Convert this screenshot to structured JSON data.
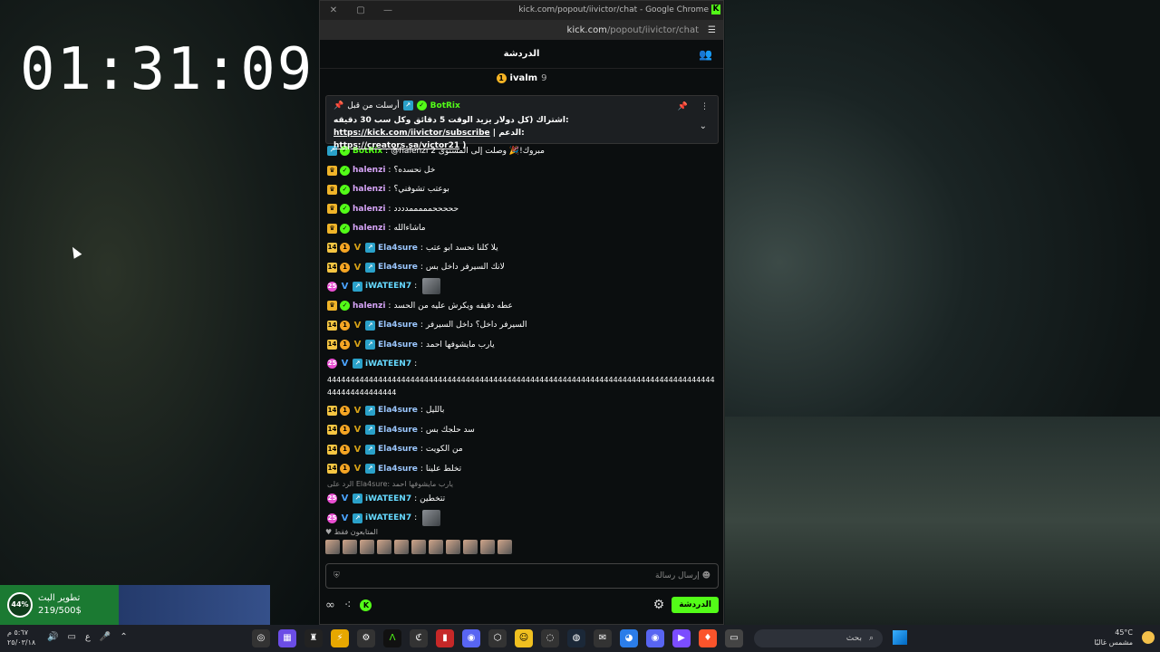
{
  "desktop": {
    "clock": "01:31:09"
  },
  "browser": {
    "title": "kick.com/popout/iivictor/chat - Google Chrome",
    "url_host": "kick.com",
    "url_path": "/popout/iivictor/chat",
    "controls": {
      "close": "✕",
      "maximize": "▢",
      "minimize": "—"
    }
  },
  "chat": {
    "header_title": "الدردشة",
    "top_gifter": {
      "name": "ivalm",
      "count": "9"
    },
    "pinned": {
      "by_label": "أرسلت من قبل",
      "author": "BotRix",
      "text_part1": "اشتراك (كل دولار يزيد الوقت 5 دقائق وكل سب 30 دقيقه:",
      "link1": "https://kick.com/iivictor/subscribe",
      "text_part2": "| الدعم:",
      "link2": "https://creators.sa/victor21",
      "text_end": ")"
    },
    "messages": [
      {
        "user": "BotRix",
        "color": "#53fc18",
        "type": "bot",
        "text": "@halenzi مبروك!🎉 وصلت إلى المستوى 2"
      },
      {
        "user": "halenzi",
        "color": "#d6a4f7",
        "type": "crown",
        "text": "خل نحسده؟"
      },
      {
        "user": "halenzi",
        "color": "#d6a4f7",
        "type": "crown",
        "text": "بوعتب تشوفني؟"
      },
      {
        "user": "halenzi",
        "color": "#d6a4f7",
        "type": "crown",
        "text": "حححححمممممدددد"
      },
      {
        "user": "halenzi",
        "color": "#d6a4f7",
        "type": "crown",
        "text": "ماشاءالله"
      },
      {
        "user": "Ela4sure",
        "color": "#9bc7ff",
        "type": "sub14",
        "text": "يلا كلنا نحسد ابو عتب"
      },
      {
        "user": "Ela4sure",
        "color": "#9bc7ff",
        "type": "sub14",
        "text": "لانك السيرفر داخل بس"
      },
      {
        "user": "iWATEEN7",
        "color": "#66d9ff",
        "type": "sub25",
        "text": "",
        "thumb": true
      },
      {
        "user": "halenzi",
        "color": "#d6a4f7",
        "type": "crown",
        "text": "عطه دقيقه ويكرش عليه من الحسد"
      },
      {
        "user": "Ela4sure",
        "color": "#9bc7ff",
        "type": "sub14",
        "text": "السيرفر داخل؟ داخل السيرفر"
      },
      {
        "user": "Ela4sure",
        "color": "#9bc7ff",
        "type": "sub14",
        "text": "يارب مايشوفها احمد"
      },
      {
        "user": "iWATEEN7",
        "color": "#66d9ff",
        "type": "sub25",
        "text": "",
        "long": "444444444444444444444444444444444444444444444444444444444444444444444444444444444444444444444444444"
      },
      {
        "user": "Ela4sure",
        "color": "#9bc7ff",
        "type": "sub14",
        "text": "بالليل"
      },
      {
        "user": "Ela4sure",
        "color": "#9bc7ff",
        "type": "sub14",
        "text": "سد حلجك بس"
      },
      {
        "user": "Ela4sure",
        "color": "#9bc7ff",
        "type": "sub14",
        "text": "من الكويت"
      },
      {
        "user": "Ela4sure",
        "color": "#9bc7ff",
        "type": "sub14",
        "text": "تخلط علينا"
      },
      {
        "user": "iWATEEN7",
        "color": "#66d9ff",
        "type": "sub25",
        "text": "تتخطين",
        "reply": "الرد على Ela4sure: يارب مايشوفها احمد"
      },
      {
        "user": "iWATEEN7",
        "color": "#66d9ff",
        "type": "sub25",
        "text": "",
        "thumb": true
      }
    ],
    "emote_label": "المتابعون فقط",
    "input_placeholder": "إرسال رسالة",
    "send_label": "الدردشة"
  },
  "goal": {
    "title": "تطوير البث",
    "progress": "219/500$",
    "percent": "44%"
  },
  "taskbar": {
    "time": "٥:٦٧ م",
    "date": "٢٥/٠٣/١٨",
    "lang": "ع",
    "search_placeholder": "بحث",
    "weather_temp": "45°C",
    "weather_desc": "مشمس غالبًا"
  },
  "colors": {
    "kick_green": "#53fc18",
    "goal_green": "#1b7a32",
    "goal_blue": "#35508a"
  }
}
